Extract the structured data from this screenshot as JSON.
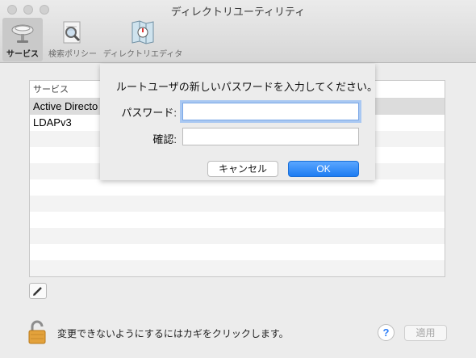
{
  "window": {
    "title": "ディレクトリユーティリティ"
  },
  "toolbar": {
    "items": [
      {
        "label": "サービス",
        "icon": "services-satellite-icon",
        "selected": true
      },
      {
        "label": "検索ポリシー",
        "icon": "search-policy-icon",
        "selected": false
      },
      {
        "label": "ディレクトリエディタ",
        "icon": "directory-editor-map-icon",
        "selected": false
      }
    ]
  },
  "services_table": {
    "header": "サービス",
    "rows": [
      "Active Directo",
      "LDAPv3"
    ]
  },
  "sheet": {
    "message": "ルートユーザの新しいパスワードを入力してください。",
    "password_label": "パスワード:",
    "password_value": "",
    "confirm_label": "確認:",
    "confirm_value": "",
    "cancel_label": "キャンセル",
    "ok_label": "OK"
  },
  "footer": {
    "lock_text": "変更できないようにするにはカギをクリックします。",
    "help_label": "?",
    "apply_label": "適用"
  },
  "colors": {
    "accent": "#1d7cf2",
    "focus_ring": "#a9c8f2"
  }
}
